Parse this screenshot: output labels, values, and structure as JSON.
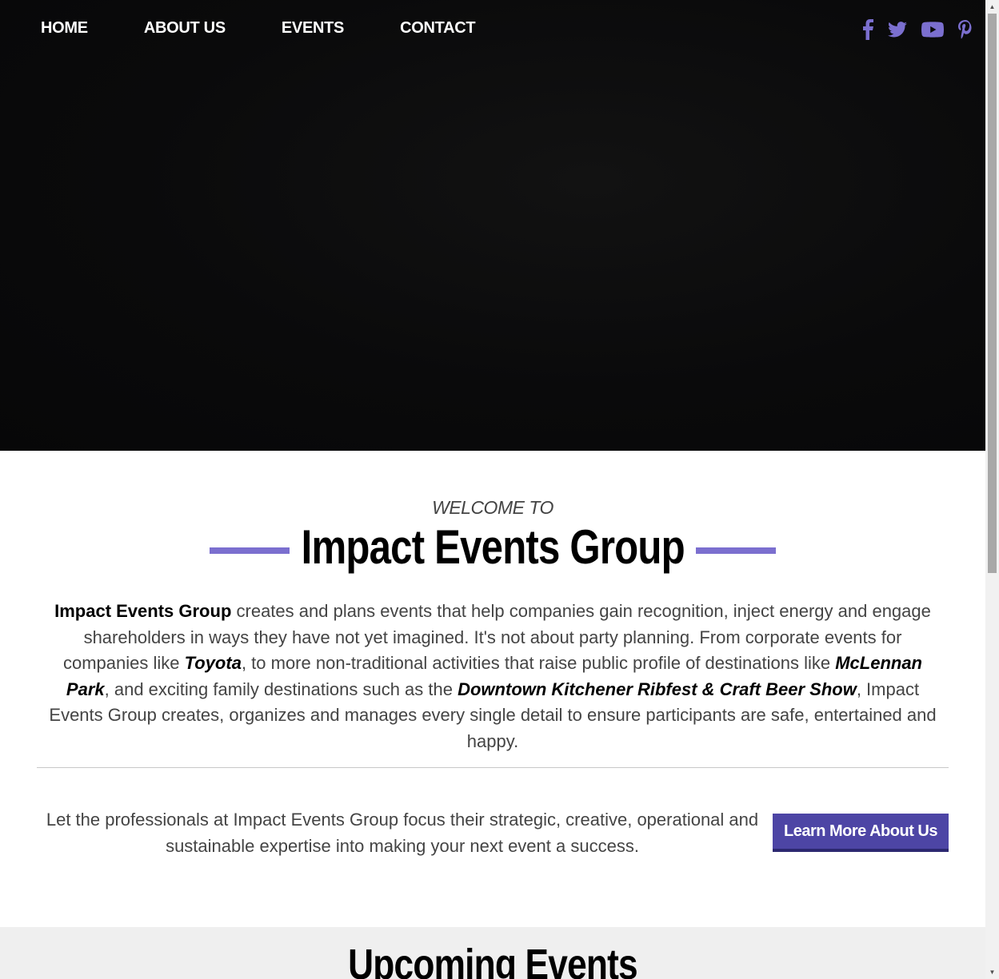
{
  "nav": {
    "items": [
      "HOME",
      "ABOUT US",
      "EVENTS",
      "CONTACT"
    ]
  },
  "social": {
    "icons": [
      "facebook-icon",
      "twitter-icon",
      "youtube-icon",
      "pinterest-icon"
    ],
    "color": "#7b6fcf"
  },
  "welcome": {
    "pre": "WELCOME TO",
    "title": "Impact Events Group"
  },
  "intro": {
    "brand": "Impact Events Group",
    "p1": " creates and plans events that help companies gain recognition, inject energy and engage shareholders in ways they have not yet imagined. It's not about party planning. From corporate events for companies like ",
    "toyota": "Toyota",
    "p2": ", to more non-traditional activities that raise public profile of destinations like ",
    "mclennan": "McLennan Park",
    "p3": ", and exciting family destinations such as the ",
    "ribfest": "Downtown Kitchener Ribfest & Craft Beer Show",
    "p4": ", Impact Events Group creates, organizes and manages every single detail to ensure participants are safe, entertained and happy."
  },
  "cta": {
    "text": "Let the professionals at Impact Events Group focus their strategic, creative, operational and sustainable expertise into making your next event a success.",
    "button": "Learn More About Us"
  },
  "upcoming": {
    "title": "Upcoming Events"
  },
  "colors": {
    "accent": "#7b6fcf",
    "button": "#4d45a5",
    "hero_bg": "#0a0a0b"
  }
}
